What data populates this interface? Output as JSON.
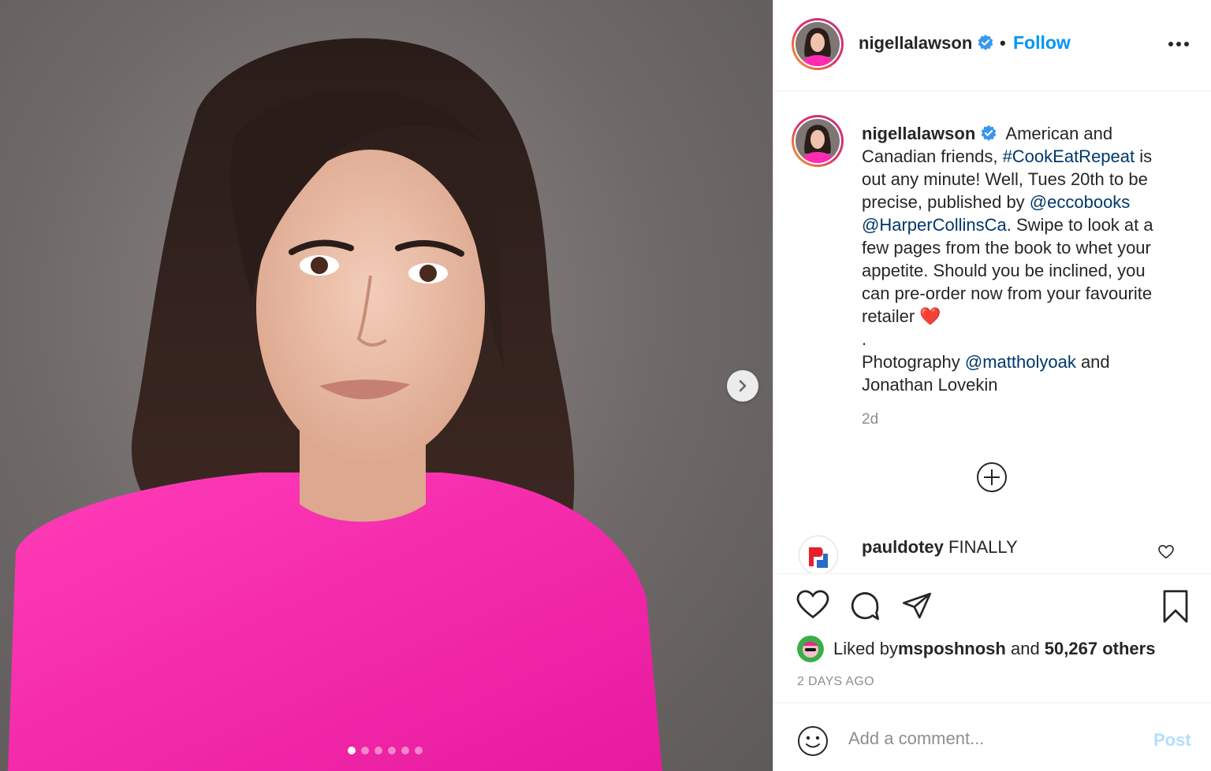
{
  "post": {
    "username": "nigellalawson",
    "verified": true,
    "follow_label": "Follow",
    "bullet": "•",
    "media": {
      "slide_count": 6,
      "active_slide": 1
    }
  },
  "caption": {
    "username": "nigellalawson",
    "text_1": "American and Canadian friends, ",
    "hashtag": "#CookEatRepeat",
    "text_2": " is out any minute! Well, Tues 20th to be precise, published by ",
    "mention_1": "@eccobooks",
    "mention_2": "@HarperCollinsCa",
    "text_3": ". Swipe to look at a few pages from the book to whet your appetite. Should you be inclined, you can pre-order now from your favourite retailer ",
    "emoji": "❤️",
    "separator": ".",
    "photo_prefix": "Photography ",
    "mention_3": "@mattholyoak",
    "photo_suffix": " and Jonathan Lovekin",
    "time": "2d"
  },
  "comments": [
    {
      "username": "pauldotey",
      "text": "FINALLY"
    }
  ],
  "likes": {
    "prefix": "Liked by ",
    "user": "msposhnosh",
    "middle": " and ",
    "count": "50,267 others"
  },
  "date": "2 DAYS AGO",
  "add_comment": {
    "placeholder": "Add a comment...",
    "post_label": "Post"
  },
  "colors": {
    "accent": "#0095f6",
    "link": "#00376b",
    "muted": "#8e8e8e",
    "sweater": "#ff2bb0"
  },
  "icons": [
    "chevron-right-icon",
    "verified-icon",
    "more-icon",
    "plus-circle-icon",
    "heart-icon",
    "comment-icon",
    "share-icon",
    "bookmark-icon",
    "emoji-icon"
  ]
}
